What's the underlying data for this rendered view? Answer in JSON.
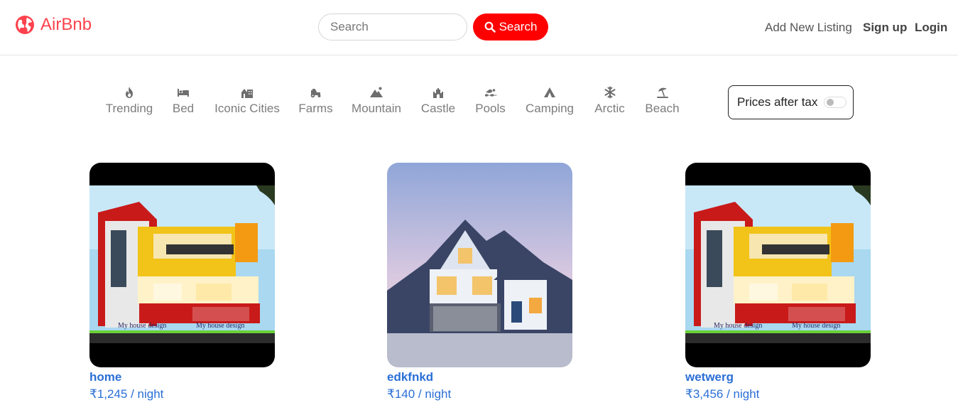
{
  "brand": {
    "name": "AirBnb",
    "icon": "globe-icon",
    "color": "#fe424d"
  },
  "search": {
    "placeholder": "Search",
    "button_label": "Search",
    "button_color": "#fe0000"
  },
  "nav": {
    "add_listing": "Add New Listing",
    "signup": "Sign up",
    "login": "Login"
  },
  "filters": [
    {
      "label": "Trending",
      "icon": "fire-icon"
    },
    {
      "label": "Bed",
      "icon": "bed-icon"
    },
    {
      "label": "Iconic Cities",
      "icon": "city-icon"
    },
    {
      "label": "Farms",
      "icon": "tractor-icon"
    },
    {
      "label": "Mountain",
      "icon": "mountain-icon"
    },
    {
      "label": "Castle",
      "icon": "castle-icon"
    },
    {
      "label": "Pools",
      "icon": "swimmer-icon"
    },
    {
      "label": "Camping",
      "icon": "tent-icon"
    },
    {
      "label": "Arctic",
      "icon": "snowflake-icon"
    },
    {
      "label": "Beach",
      "icon": "umbrella-beach-icon"
    }
  ],
  "tax_toggle": {
    "label": "Prices after tax",
    "enabled": false
  },
  "listings": [
    {
      "title": "home",
      "price": "₹1,245 / night"
    },
    {
      "title": "edkfnkd",
      "price": "₹140 / night"
    },
    {
      "title": "wetwerg",
      "price": "₹3,456 / night"
    }
  ],
  "image_text": "My house design"
}
